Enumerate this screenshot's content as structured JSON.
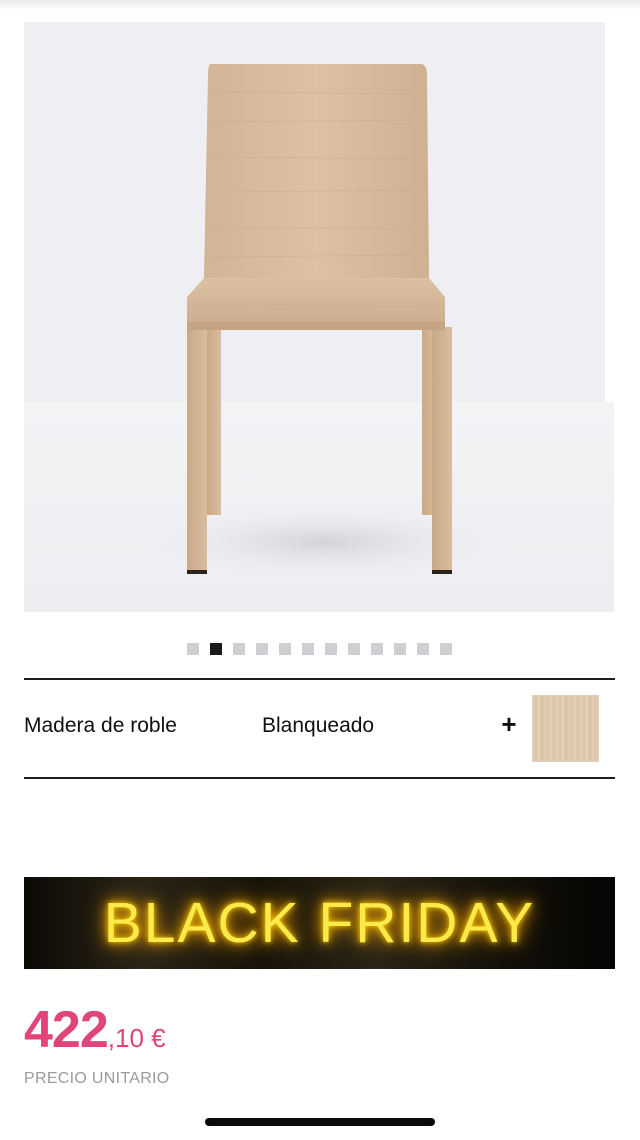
{
  "gallery": {
    "image_subject": "chair-photo",
    "slide_count": 12,
    "active_slide_index": 1
  },
  "option": {
    "material_label": "Madera de roble",
    "finish_value": "Blanqueado",
    "expand_glyph": "+",
    "swatch_icon": "oak-wood-swatch"
  },
  "promo": {
    "banner_text": "BLACK FRIDAY",
    "text_color": "#fde94a"
  },
  "price": {
    "integer": "422",
    "decimal_currency": ",10 €",
    "unit_label": "PRECIO UNITARIO",
    "color": "#e0447a"
  }
}
